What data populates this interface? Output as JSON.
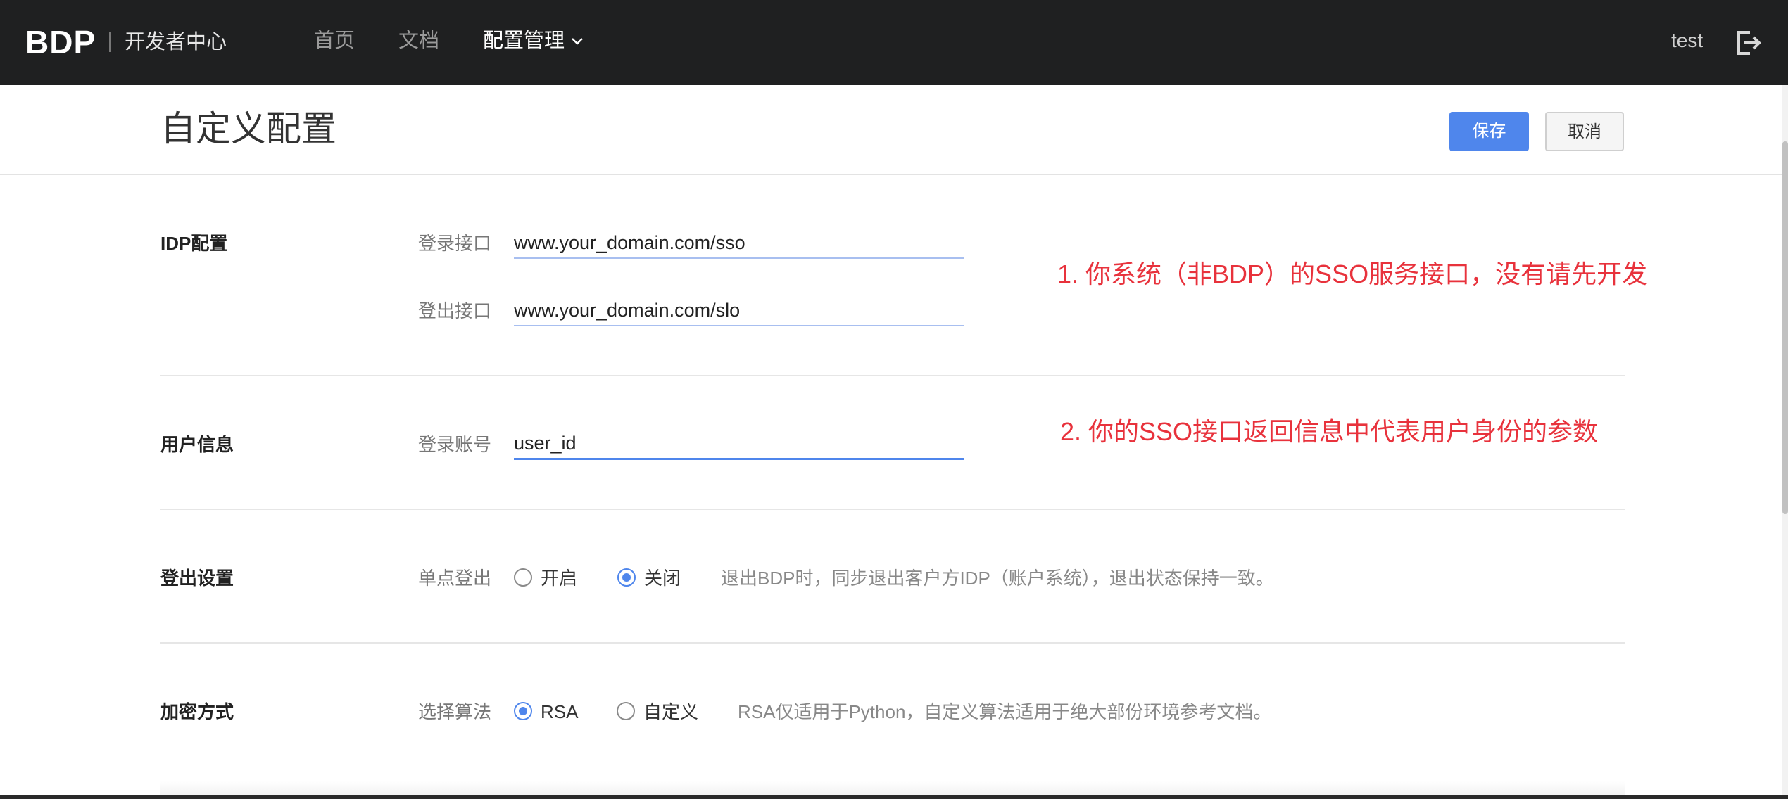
{
  "header": {
    "logo": "BDP",
    "subtitle": "开发者中心",
    "nav": {
      "home": "首页",
      "docs": "文档",
      "config": "配置管理"
    },
    "username": "test"
  },
  "page": {
    "title": "自定义配置",
    "save_label": "保存",
    "cancel_label": "取消"
  },
  "idp": {
    "title": "IDP配置",
    "login_label": "登录接口",
    "login_value": "www.your_domain.com/sso",
    "logout_label": "登出接口",
    "logout_value": "www.your_domain.com/slo",
    "annotation": "1. 你系统（非BDP）的SSO服务接口，没有请先开发"
  },
  "user_info": {
    "title": "用户信息",
    "account_label": "登录账号",
    "account_value": "user_id",
    "annotation": "2. 你的SSO接口返回信息中代表用户身份的参数"
  },
  "logout_settings": {
    "title": "登出设置",
    "sso_label": "单点登出",
    "option_on": "开启",
    "option_off": "关闭",
    "selected": "关闭",
    "hint": "退出BDP时，同步退出客户方IDP（账户系统），退出状态保持一致。"
  },
  "encryption": {
    "title": "加密方式",
    "algorithm_label": "选择算法",
    "option_rsa": "RSA",
    "option_custom": "自定义",
    "selected": "RSA",
    "hint": "RSA仅适用于Python，自定义算法适用于绝大部份环境参考文档。"
  },
  "colors": {
    "topbar": "#1f2021",
    "primary": "#4f86ec",
    "annotation": "#e8323c"
  }
}
